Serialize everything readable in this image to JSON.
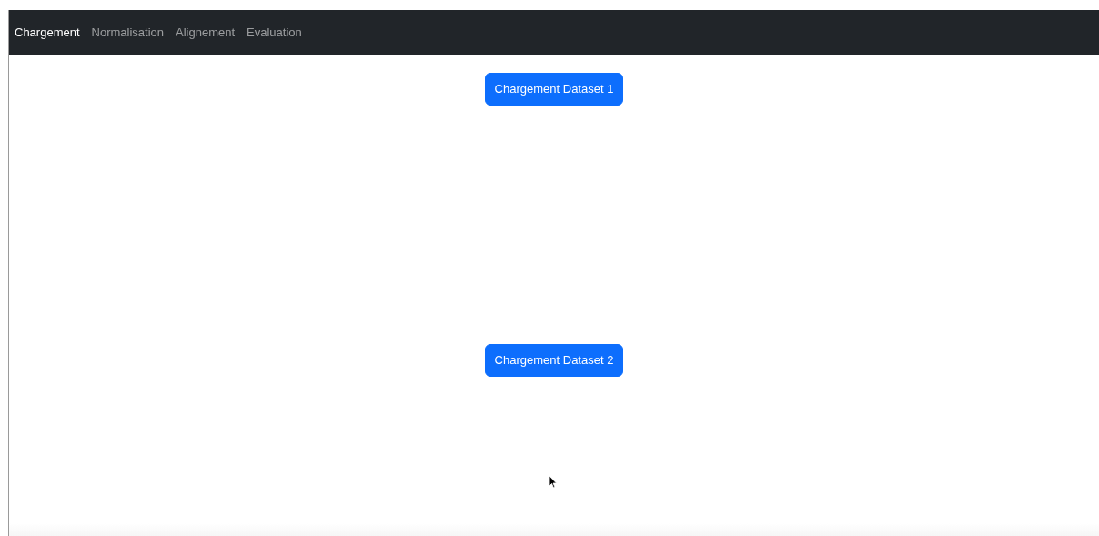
{
  "navbar": {
    "items": [
      {
        "label": "Chargement",
        "selected": true
      },
      {
        "label": "Normalisation",
        "selected": false
      },
      {
        "label": "Alignement",
        "selected": false
      },
      {
        "label": "Evaluation",
        "selected": false
      }
    ]
  },
  "buttons": [
    "Chargement Dataset 1",
    "Chargement Dataset 2"
  ]
}
